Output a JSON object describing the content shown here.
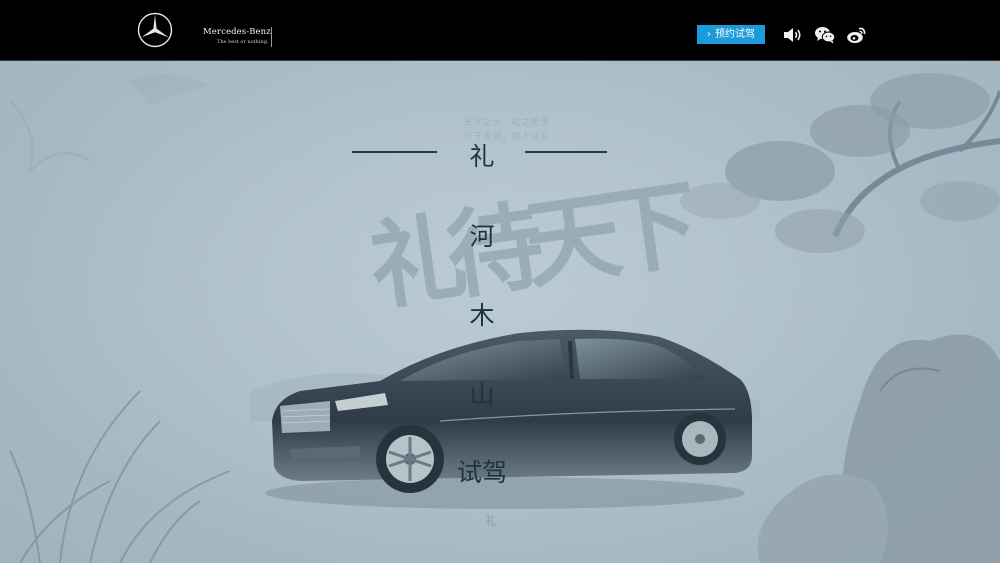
{
  "header": {
    "brand_name": "Mercedes-Benz",
    "brand_slogan": "The best or nothing.",
    "cta_label": "预约试驾",
    "icons": [
      "mercedes-star-icon",
      "sound-icon",
      "wechat-icon",
      "weibo-icon"
    ]
  },
  "main": {
    "background_calligraphy": "礼待天下",
    "ghost_verse_lines": [
      "天下之大，礼之所至",
      "行于世间，待人以礼"
    ],
    "title_lines": [
      "礼",
      "河",
      "木",
      "山",
      "试驾"
    ],
    "seal_text": "礼"
  },
  "colors": {
    "topbar": "#000000",
    "cta": "#1d9ad9",
    "paper": "#a9bcc6",
    "ink": "#1d3340"
  }
}
